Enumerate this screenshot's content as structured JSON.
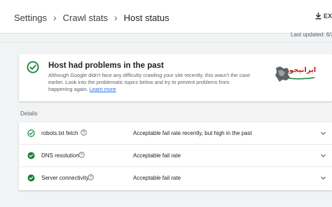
{
  "breadcrumb": {
    "items": [
      "Settings",
      "Crawl stats"
    ],
    "current": "Host status",
    "separator": "›"
  },
  "export": {
    "label": "EX",
    "icon": "download-icon"
  },
  "last_updated": "Last updated: 6/2",
  "status_card": {
    "icon": "check-circle-outline-icon",
    "title": "Host had problems in the past",
    "body": "Although Google didn't face any difficulty crawling your site recently, this wasn't the case earlier. Look into the problematic topics below and try to prevent problems from happening again.",
    "link": "Learn more"
  },
  "watermark": {
    "text": "ایرانیجو",
    "icon": "iran-map-logo"
  },
  "details": {
    "label": "Details",
    "rows": [
      {
        "name": "robots.txt fetch",
        "rate": "Acceptable fail rate recently, but high in the past",
        "status": "past-issue"
      },
      {
        "name": "DNS resolution",
        "rate": "Acceptable fail rate",
        "status": "ok"
      },
      {
        "name": "Server connectivity",
        "rate": "Acceptable fail rate",
        "status": "ok"
      }
    ]
  },
  "colors": {
    "green": "#188038",
    "link": "#1a73e8",
    "text": "#202124",
    "muted": "#5f6368"
  }
}
